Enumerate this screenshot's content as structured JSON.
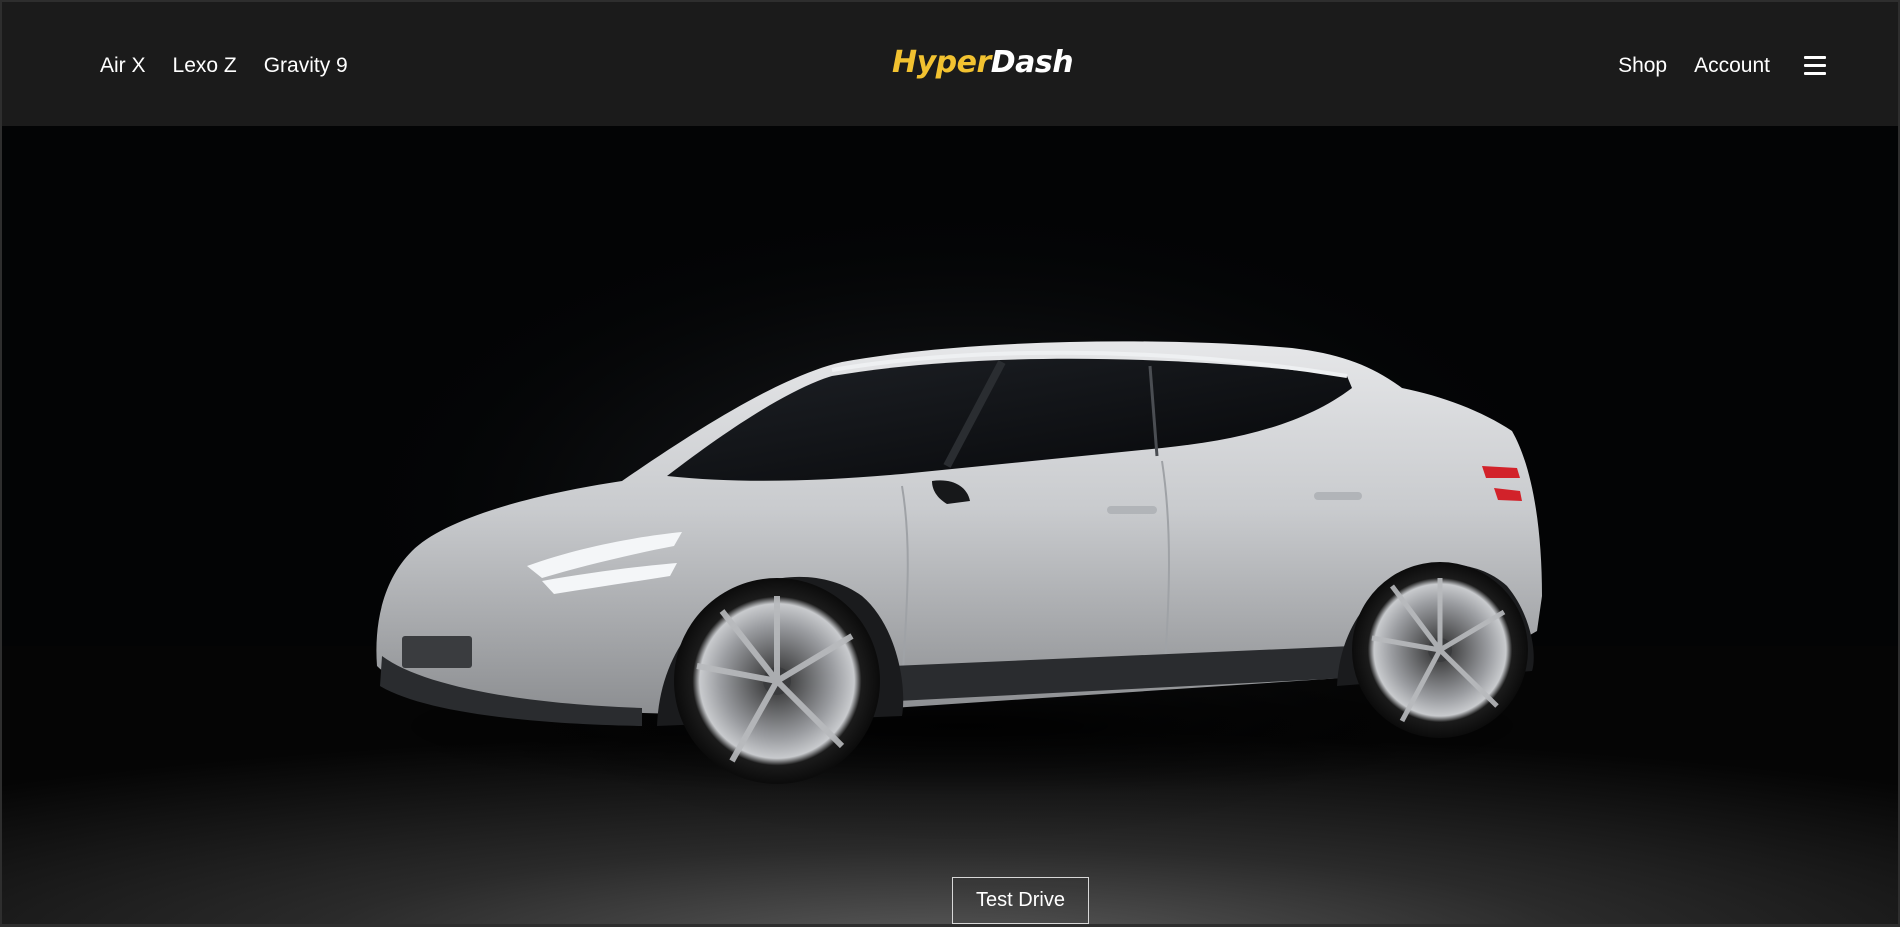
{
  "header": {
    "nav_left": [
      {
        "label": "Air X"
      },
      {
        "label": "Lexo Z"
      },
      {
        "label": "Gravity 9"
      }
    ],
    "logo": {
      "part_a": "Hyper",
      "part_b": "Dash"
    },
    "nav_right": [
      {
        "label": "Shop"
      },
      {
        "label": "Account"
      }
    ],
    "menu_icon": "hamburger-menu-icon"
  },
  "hero": {
    "image": "silver electric crossover SUV on dark studio floor",
    "cta_label": "Test Drive"
  },
  "colors": {
    "header_bg": "#1b1b1b",
    "logo_accent": "#f2c230",
    "text": "#ffffff",
    "hero_bg": "#030405"
  }
}
